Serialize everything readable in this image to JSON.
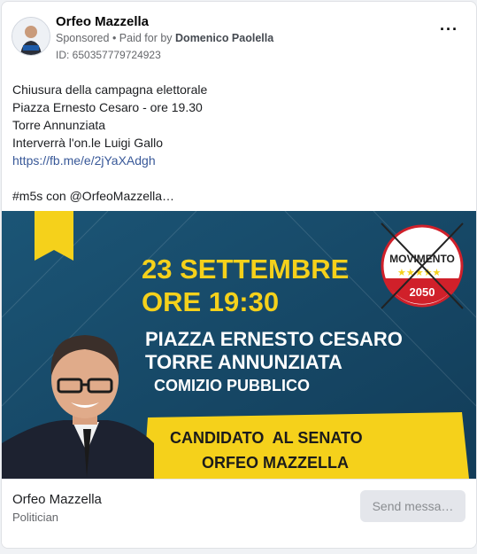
{
  "header": {
    "page_name": "Orfeo Mazzella",
    "sponsored": "Sponsored",
    "paid_for_prefix": " • Paid for by ",
    "payer": "Domenico Paolella",
    "ad_id": "ID: 650357779724923",
    "more_icon": "ellipsis-icon"
  },
  "post": {
    "lines": [
      "Chiusura della campagna elettorale",
      "Piazza Ernesto Cesaro - ore 19.30",
      "Torre Annunziata",
      "Interverrà l'on.le Luigi Gallo"
    ],
    "link": "https://fb.me/e/2jYaXAdgh",
    "hashtags": "#m5s con @OrfeoMazzella…"
  },
  "creative": {
    "date": "23 SETTEMBRE",
    "time": "ORE 19:30",
    "place1": "PIAZZA ERNESTO CESARO",
    "place2": "TORRE ANNUNZIATA",
    "event": "COMIZIO PUBBLICO",
    "candidate_role": "CANDIDATO  AL SENATO",
    "candidate_name": "ORFEO MAZZELLA",
    "logo_text": "MOVIMENTO",
    "logo_year": "2050",
    "colors": {
      "background": "#1a4d6e",
      "accent": "#f5d11b",
      "logo_red": "#d0202a"
    }
  },
  "footer": {
    "name": "Orfeo Mazzella",
    "category": "Politician",
    "button": "Send messa…"
  }
}
